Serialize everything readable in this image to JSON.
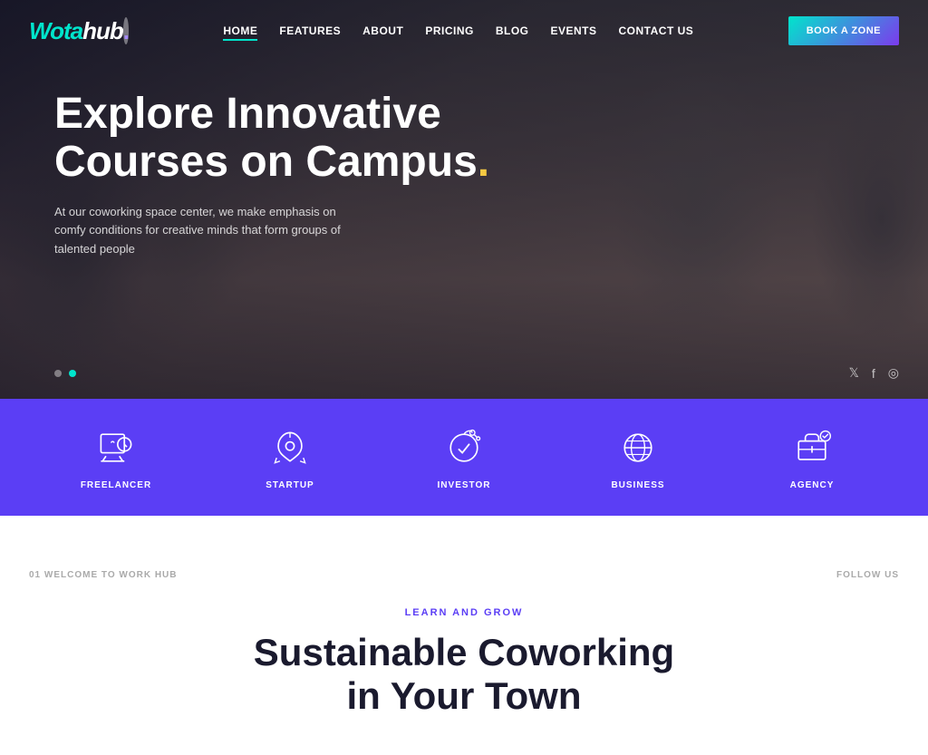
{
  "brand": {
    "name_part1": "Wota",
    "name_part2": "hub",
    "dot": "."
  },
  "nav": {
    "links": [
      {
        "label": "HOME",
        "active": true
      },
      {
        "label": "FEATURES",
        "active": false
      },
      {
        "label": "ABOUT",
        "active": false
      },
      {
        "label": "PRICING",
        "active": false
      },
      {
        "label": "BLOG",
        "active": false
      },
      {
        "label": "EVENTS",
        "active": false
      },
      {
        "label": "CONTACT US",
        "active": false
      }
    ],
    "cta_label": "BOOK A ZONE"
  },
  "hero": {
    "title_line1": "Explore Innovative",
    "title_line2": "Courses on Campus",
    "title_dot": ".",
    "subtitle": "At our coworking space center, we make emphasis on comfy conditions for creative minds that form groups of talented people"
  },
  "services": [
    {
      "label": "FREELANCER",
      "icon": "freelancer"
    },
    {
      "label": "STARTUP",
      "icon": "startup"
    },
    {
      "label": "INVESTOR",
      "icon": "investor"
    },
    {
      "label": "BUSINESS",
      "icon": "business"
    },
    {
      "label": "AGENCY",
      "icon": "agency"
    }
  ],
  "content": {
    "meta_left": "01 WELCOME TO WORK HUB",
    "meta_right": "FOLLOW US",
    "tag": "LEARN AND GROW",
    "title_line1": "Sustainable Coworking",
    "title_line2": "in Your Town"
  },
  "social": {
    "twitter": "𝕏",
    "facebook": "f",
    "instagram": "◎"
  },
  "colors": {
    "accent_teal": "#00e5cc",
    "accent_purple": "#5b3ef5",
    "accent_yellow": "#f5c842"
  }
}
